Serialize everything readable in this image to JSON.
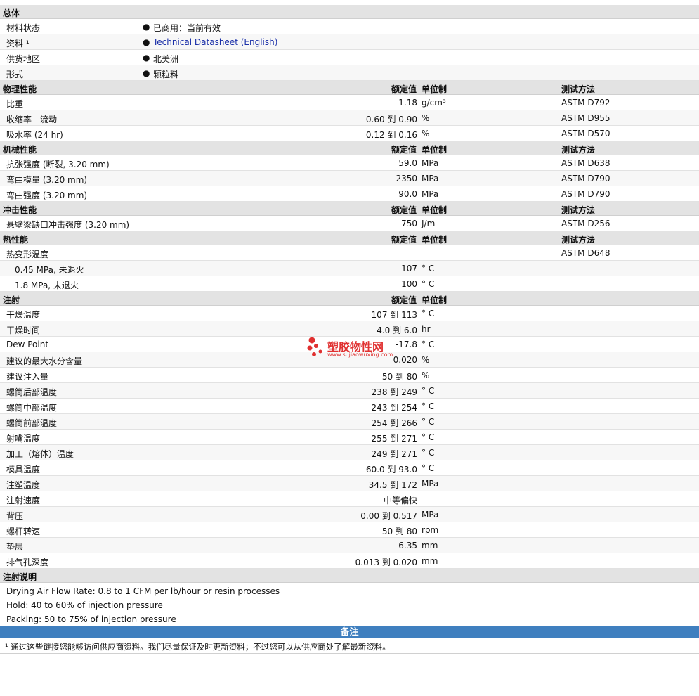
{
  "sections": {
    "general": {
      "title": "总体"
    },
    "physical": {
      "title": "物理性能",
      "h_value": "额定值",
      "h_unit": "单位制",
      "h_test": "测试方法"
    },
    "mechanical": {
      "title": "机械性能",
      "h_value": "额定值",
      "h_unit": "单位制",
      "h_test": "测试方法"
    },
    "impact": {
      "title": "冲击性能",
      "h_value": "额定值",
      "h_unit": "单位制",
      "h_test": "测试方法"
    },
    "thermal": {
      "title": "热性能",
      "h_value": "额定值",
      "h_unit": "单位制",
      "h_test": "测试方法"
    },
    "injection": {
      "title": "注射",
      "h_value": "额定值",
      "h_unit": "单位制"
    },
    "inj_notes": {
      "title": "注射说明"
    }
  },
  "general": [
    {
      "label": "材料状态",
      "value": "已商用：当前有效"
    },
    {
      "label": "资料 ¹",
      "value": "Technical Datasheet (English)"
    },
    {
      "label": "供货地区",
      "value": "北美洲"
    },
    {
      "label": "形式",
      "value": "颗粒料"
    }
  ],
  "physical": [
    {
      "label": "比重",
      "value": "1.18",
      "unit": "g/cm³",
      "test": "ASTM D792"
    },
    {
      "label": "收缩率  - 流动",
      "value": "0.60 到  0.90",
      "unit": "%",
      "test": "ASTM D955"
    },
    {
      "label": "吸水率  (24 hr)",
      "value": "0.12 到  0.16",
      "unit": "%",
      "test": "ASTM D570"
    }
  ],
  "mechanical": [
    {
      "label": "抗张强度  (断裂, 3.20 mm)",
      "value": "59.0",
      "unit": "MPa",
      "test": "ASTM D638"
    },
    {
      "label": "弯曲模量  (3.20 mm)",
      "value": "2350",
      "unit": "MPa",
      "test": "ASTM D790"
    },
    {
      "label": "弯曲强度  (3.20 mm)",
      "value": "90.0",
      "unit": "MPa",
      "test": "ASTM D790"
    }
  ],
  "impact": [
    {
      "label": "悬壁梁缺口冲击强度  (3.20 mm)",
      "value": "750",
      "unit": "J/m",
      "test": "ASTM D256"
    }
  ],
  "thermal": [
    {
      "label": "热变形温度",
      "value": "",
      "unit": "",
      "test": "ASTM D648"
    },
    {
      "label": "0.45 MPa, 未退火",
      "value": "107",
      "unit": "° C",
      "test": ""
    },
    {
      "label": "1.8 MPa, 未退火",
      "value": "100",
      "unit": "° C",
      "test": ""
    }
  ],
  "injection": [
    {
      "label": "干燥温度",
      "value": "107 到  113",
      "unit": "° C"
    },
    {
      "label": "干燥时间",
      "value": "4.0 到  6.0",
      "unit": "hr"
    },
    {
      "label": "Dew Point",
      "value": "-17.8",
      "unit": "° C"
    },
    {
      "label": "建议的最大水分含量",
      "value": "0.020",
      "unit": "%"
    },
    {
      "label": "建议注入量",
      "value": "50 到  80",
      "unit": "%"
    },
    {
      "label": "螺筒后部温度",
      "value": "238 到  249",
      "unit": "° C"
    },
    {
      "label": "螺筒中部温度",
      "value": "243 到  254",
      "unit": "° C"
    },
    {
      "label": "螺筒前部温度",
      "value": "254 到  266",
      "unit": "° C"
    },
    {
      "label": "射嘴温度",
      "value": "255 到  271",
      "unit": "° C"
    },
    {
      "label": "加工（熔体）温度",
      "value": "249 到  271",
      "unit": "° C"
    },
    {
      "label": "模具温度",
      "value": "60.0 到  93.0",
      "unit": "° C"
    },
    {
      "label": "注塑温度",
      "value": "34.5 到  172",
      "unit": "MPa"
    },
    {
      "label": "注射速度",
      "value": "中等偏快",
      "unit": ""
    },
    {
      "label": "背压",
      "value": "0.00 到  0.517",
      "unit": "MPa"
    },
    {
      "label": "螺杆转速",
      "value": "50 到  80",
      "unit": "rpm"
    },
    {
      "label": "垫层",
      "value": "6.35",
      "unit": "mm"
    },
    {
      "label": "排气孔深度",
      "value": "0.013 到  0.020",
      "unit": "mm"
    }
  ],
  "inj_notes": [
    "Drying Air Flow Rate: 0.8 to 1 CFM per lb/hour or resin processes",
    "Hold: 40 to 60% of injection pressure",
    "Packing: 50 to 75% of injection pressure"
  ],
  "remarks": {
    "title": "备注",
    "footnote": "¹ 通过这些链接您能够访问供应商资料。我们尽量保证及时更新资料；不过您可以从供应商处了解最新资料。"
  },
  "watermark": {
    "name": "塑胶物性网",
    "url": "www.sujiaowuxing.com",
    "color": "#e03030"
  }
}
